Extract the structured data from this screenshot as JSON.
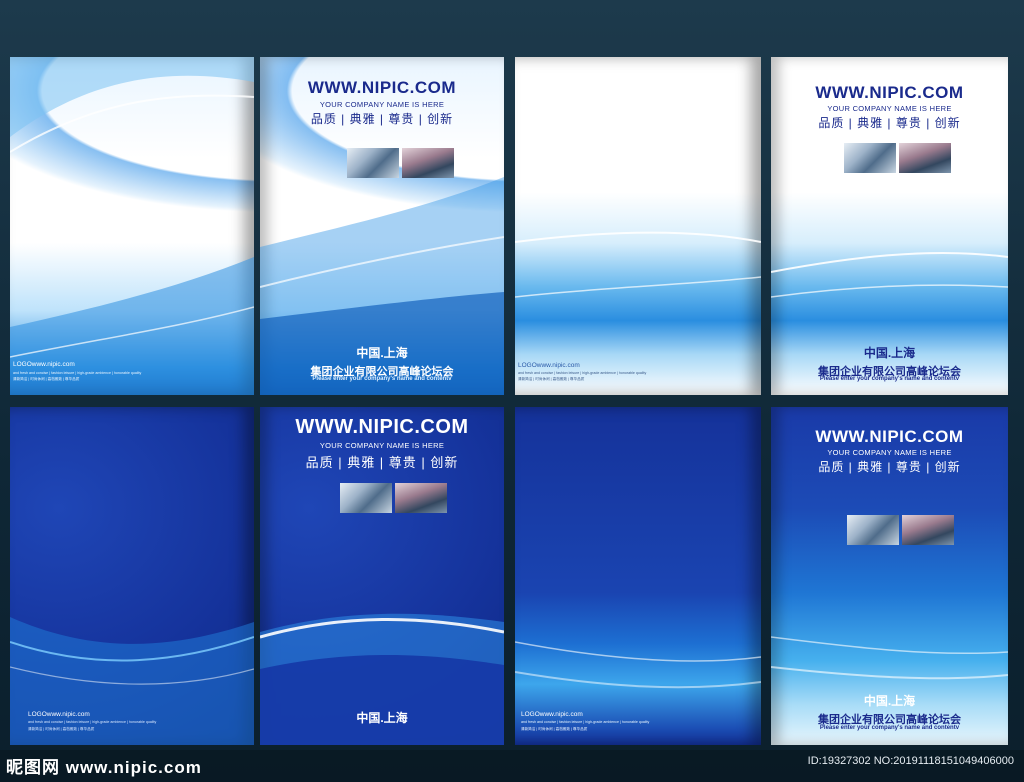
{
  "covers": {
    "url": "WWW.NIPIC.COM",
    "company": "YOUR COMPANY NAME IS HERE",
    "slogan": "品质 | 典雅 | 尊贵 | 创新",
    "city": "中国.上海",
    "group": "集团企业有限公司高峰论坛会",
    "enter": "Please enter your company's name and contentv",
    "logo": "LOGOwww.nipic.com",
    "tiny_en": "and fresh and concise | fashion leisure | high-grade ambience | honorable quality",
    "tiny_cn": "清新简洁 | 时尚休闲 | 高档雅致 | 尊华品质"
  },
  "colors": {
    "brand_dark": "#1a2a8c",
    "brand_light": "#ffffff",
    "accent": "#2b8fdf"
  },
  "watermark": {
    "logo": "昵图网 www.nipic.com",
    "id": "ID:19327302 NO:20191118151049406000"
  }
}
